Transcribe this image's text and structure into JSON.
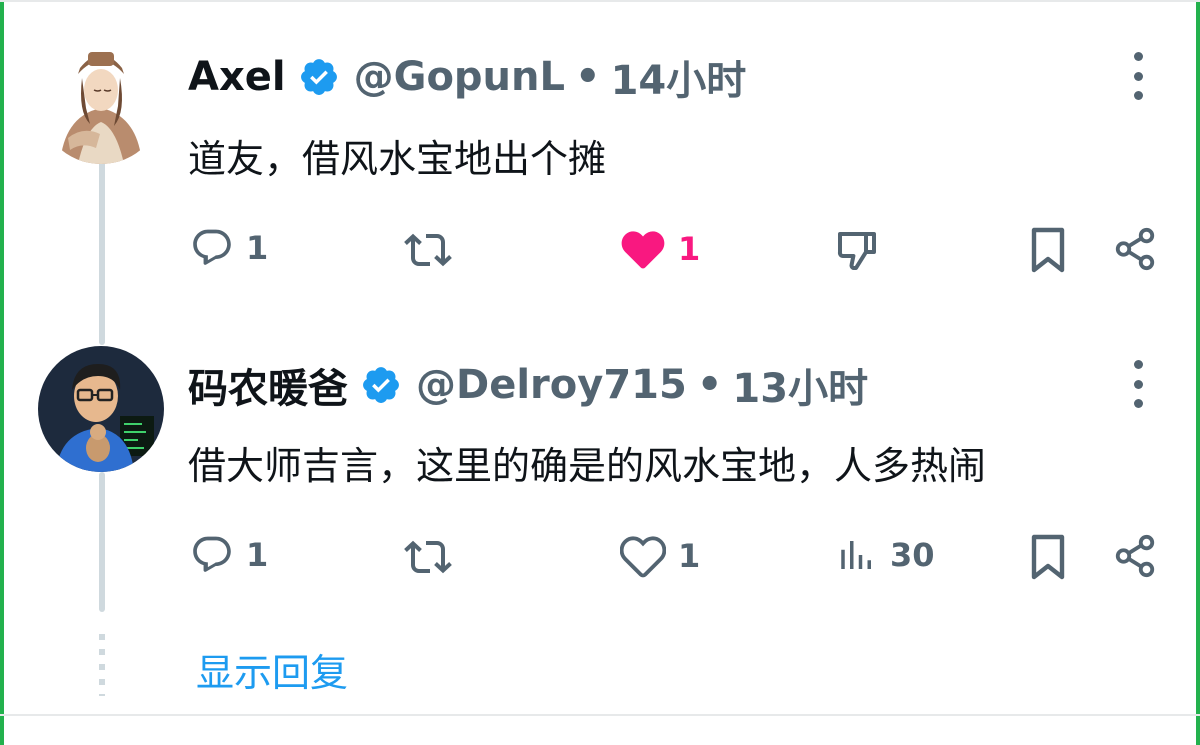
{
  "colors": {
    "accent": "#1d9bf0",
    "like": "#f91880",
    "muted": "#536471",
    "text": "#0f1419"
  },
  "tweets": [
    {
      "name": "Axel",
      "handle": "@GopunL",
      "separator": "•",
      "time": "14小时",
      "verified": true,
      "text": "道友，借风水宝地出个摊",
      "actions": {
        "reply_count": "1",
        "like_count": "1",
        "liked": true
      },
      "icons": [
        "reply-icon",
        "retweet-icon",
        "heart-filled-icon",
        "thumbs-down-icon",
        "bookmark-icon",
        "share-icon"
      ]
    },
    {
      "name": "码农暖爸",
      "handle": "@Delroy715",
      "separator": "•",
      "time": "13小时",
      "verified": true,
      "text": "借大师吉言，这里的确是的风水宝地，人多热闹",
      "actions": {
        "reply_count": "1",
        "like_count": "1",
        "liked": false,
        "views_count": "30"
      },
      "icons": [
        "reply-icon",
        "retweet-icon",
        "heart-outline-icon",
        "views-icon",
        "bookmark-icon",
        "share-icon"
      ]
    }
  ],
  "show_replies_label": "显示回复"
}
